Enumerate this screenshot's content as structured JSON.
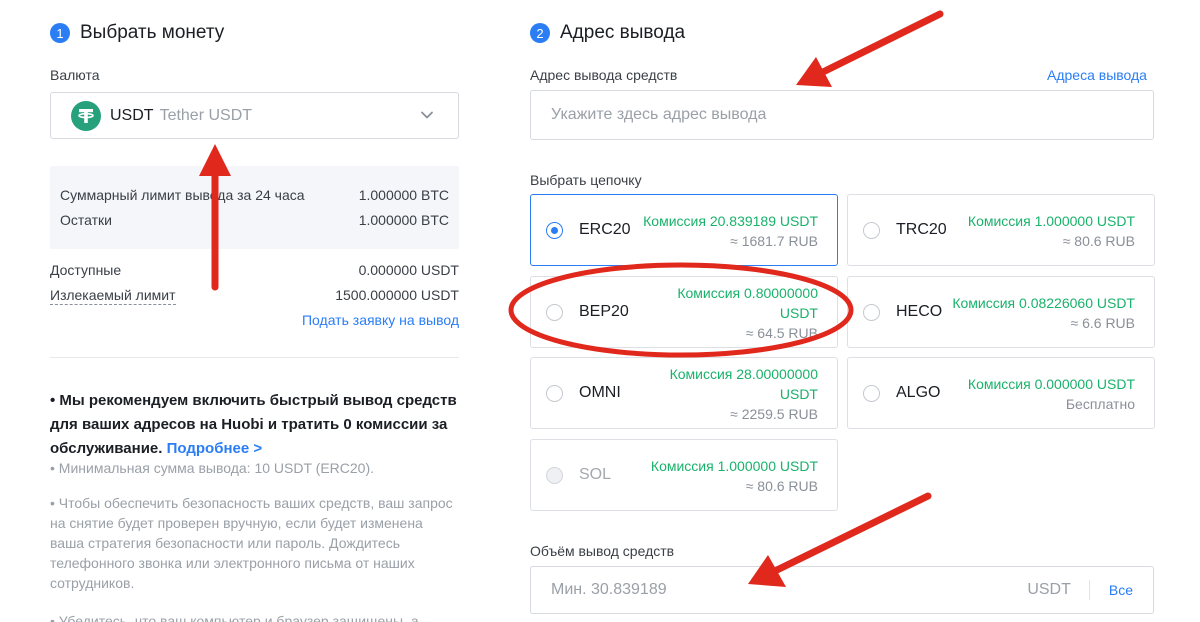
{
  "left": {
    "step_number": "1",
    "step_title": "Выбрать монету",
    "currency_label": "Валюта",
    "currency": {
      "code": "USDT",
      "name": "Tether USDT",
      "icon": "tether-icon"
    },
    "limits": [
      {
        "label": "Суммарный лимит вывода за 24 часа",
        "value": "1.000000 BTC"
      },
      {
        "label": "Остатки",
        "value": "1.000000 BTC"
      }
    ],
    "available": {
      "label": "Доступные",
      "value": "0.000000 USDT"
    },
    "withdrawable": {
      "label": "Излекаемый лимит",
      "value": "1500.000000 USDT"
    },
    "apply_link": "Подать заявку на вывод",
    "notice_text": "• Мы рекомендуем включить быстрый вывод средств для ваших адресов на Huobi и тратить 0 комиссии за обслуживание.",
    "notice_link": "Подробнее >",
    "notes": [
      "• Минимальная сумма вывода: 10 USDT (ERC20).",
      "• Чтобы обеспечить безопасность ваших средств, ваш запрос на снятие будет проверен вручную, если будет изменена ваша стратегия безопасности или пароль. Дождитесь телефонного звонка или электронного письма от наших сотрудников.",
      "• Убедитесь, что ваш компьютер и браузер защищены, а"
    ]
  },
  "right": {
    "step_number": "2",
    "step_title": "Адрес вывода",
    "address_label": "Адрес вывода средств",
    "address_link": "Адреса вывода",
    "address_placeholder": "Укажите здесь адрес вывода",
    "chain_label": "Выбрать цепочку",
    "chains": [
      {
        "name": "ERC20",
        "fee": "Комиссия 20.839189 USDT",
        "sub": "≈ 1681.7 RUB",
        "selected": true,
        "disabled": false
      },
      {
        "name": "TRC20",
        "fee": "Комиссия 1.000000 USDT",
        "sub": "≈ 80.6 RUB",
        "selected": false,
        "disabled": false
      },
      {
        "name": "BEP20",
        "fee": "Комиссия 0.80000000 USDT",
        "sub": "≈ 64.5 RUB",
        "selected": false,
        "disabled": false
      },
      {
        "name": "HECO",
        "fee": "Комиссия 0.08226060 USDT",
        "sub": "≈ 6.6 RUB",
        "selected": false,
        "disabled": false
      },
      {
        "name": "OMNI",
        "fee": "Комиссия 28.00000000 USDT",
        "sub": "≈ 2259.5 RUB",
        "selected": false,
        "disabled": false
      },
      {
        "name": "ALGO",
        "fee": "Комиссия 0.000000 USDT",
        "sub": "Бесплатно",
        "selected": false,
        "disabled": false
      },
      {
        "name": "SOL",
        "fee": "Комиссия 1.000000 USDT",
        "sub": "≈ 80.6 RUB",
        "selected": false,
        "disabled": true
      }
    ],
    "amount_label": "Объём вывод средств",
    "amount_placeholder": "Мин. 30.839189",
    "amount_unit": "USDT",
    "amount_all": "Все"
  },
  "colors": {
    "accent": "#2a7df5",
    "fee_green": "#19b26b",
    "annotation_red": "#e0281c",
    "tether": "#26a17b"
  }
}
